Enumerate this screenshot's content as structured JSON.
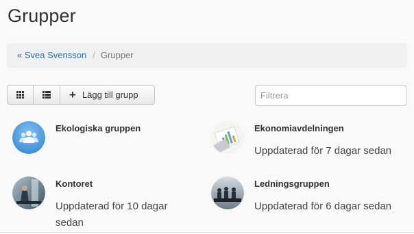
{
  "page": {
    "title": "Grupper"
  },
  "breadcrumb": {
    "parent": "« Svea Svensson",
    "separator": "/",
    "current": "Grupper"
  },
  "toolbar": {
    "grid_icon": "grid-view-icon",
    "list_icon": "list-view-icon",
    "add_label": "Lägg till grupp",
    "filter_placeholder": "Filtrera"
  },
  "groups": [
    {
      "name": "Ekologiska gruppen",
      "updated": "",
      "avatar": "people-icon"
    },
    {
      "name": "Ekonomiavdelningen",
      "updated": "Uppdaterad för 7 dagar sedan",
      "avatar": "charts-photo"
    },
    {
      "name": "Kontoret",
      "updated": "Uppdaterad för 10 dagar sedan",
      "avatar": "office-photo"
    },
    {
      "name": "Ledningsgruppen",
      "updated": "Uppdaterad för 6 dagar sedan",
      "avatar": "meeting-photo"
    }
  ],
  "colors": {
    "link": "#2a6fb4",
    "placeholder_avatar": "#4a9be0"
  }
}
